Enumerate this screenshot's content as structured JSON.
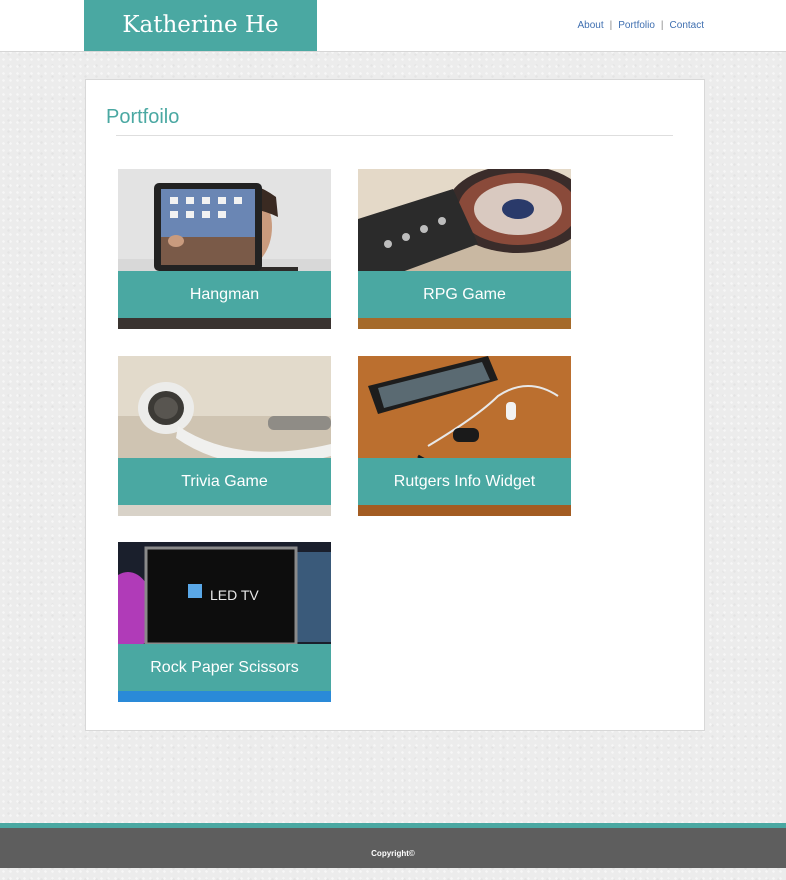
{
  "header": {
    "brand": "Katherine He",
    "nav": [
      {
        "label": "About"
      },
      {
        "label": "Portfolio"
      },
      {
        "label": "Contact"
      }
    ]
  },
  "main": {
    "title": "Portfoilo",
    "projects": [
      {
        "label": "Hangman",
        "image": "person holding tablet"
      },
      {
        "label": "RPG Game",
        "image": "DJ turntable"
      },
      {
        "label": "Trivia Game",
        "image": "earbud headphones"
      },
      {
        "label": "Rutgers Info Widget",
        "image": "smartphone with headphones on wooden table"
      },
      {
        "label": "Rock Paper Scissors",
        "image": "LED TV display"
      }
    ]
  },
  "footer": {
    "copyright": "Copyright©"
  },
  "colors": {
    "accent": "#4aa8a2",
    "link": "#3f6fb0",
    "footer": "#5e5e5e"
  }
}
